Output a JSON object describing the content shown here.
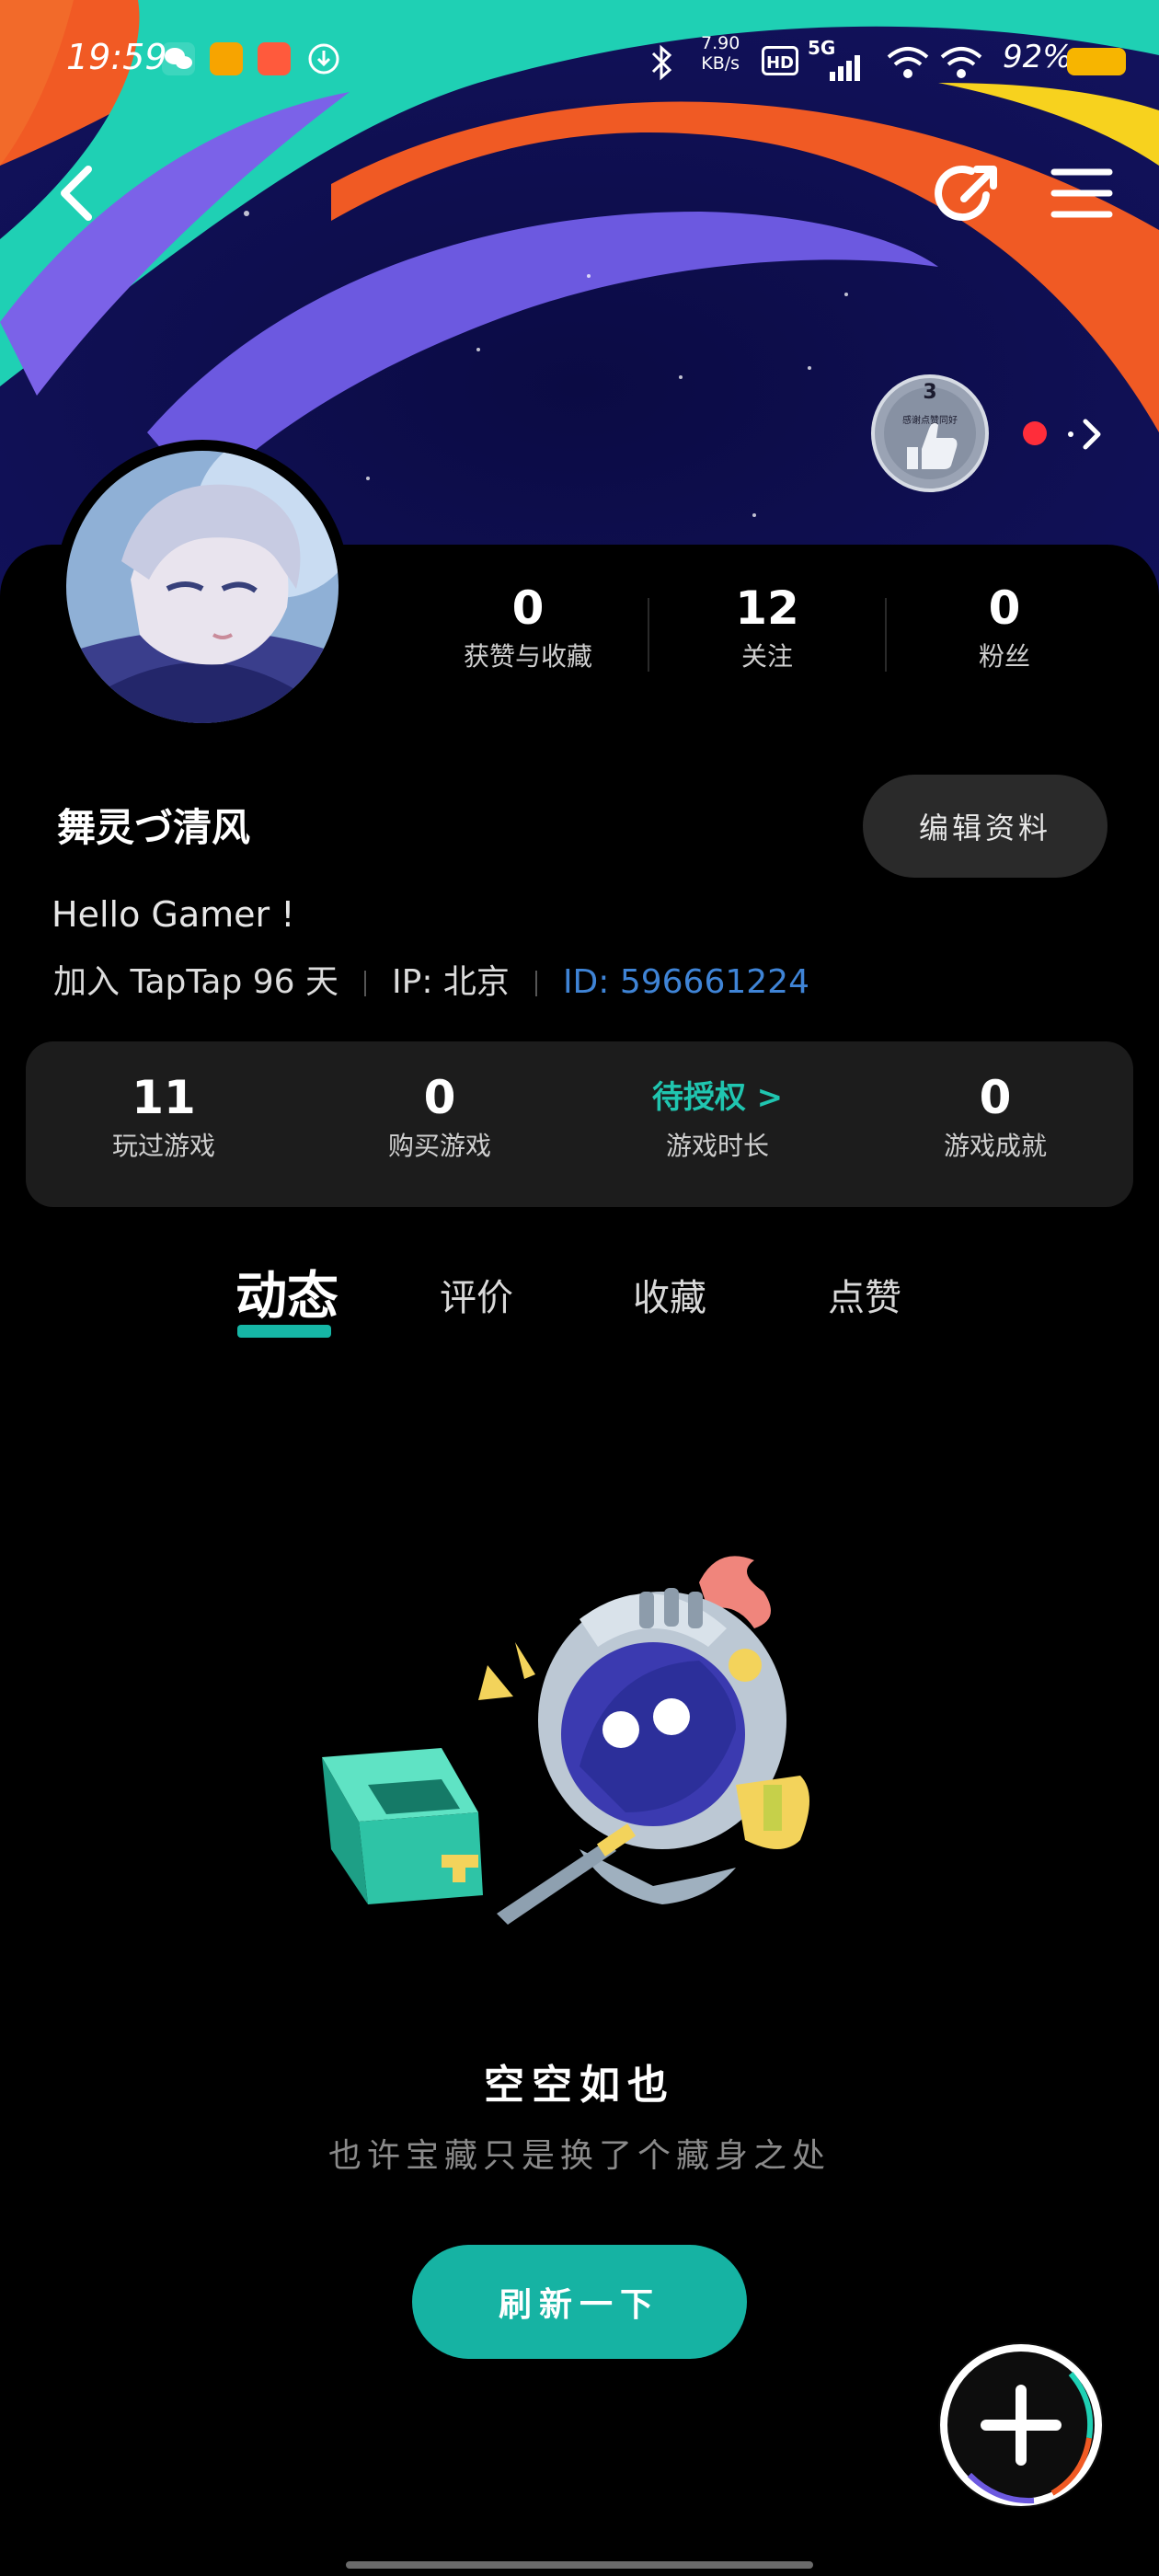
{
  "status_bar": {
    "time": "19:59",
    "speed_value": "7.90",
    "speed_unit": "KB/s",
    "hd_label": "HD",
    "network": "5G",
    "battery": "92%"
  },
  "profile": {
    "username": "舞灵づ清风",
    "edit_label": "编辑资料",
    "bio": "Hello Gamer !",
    "joined": "加入 TapTap 96 天",
    "ip": "IP: 北京",
    "user_id": "ID: 596661224",
    "badge_count": "3",
    "badge_caption": "感谢点赞同好"
  },
  "stats": [
    {
      "value": "0",
      "label": "获赞与收藏"
    },
    {
      "value": "12",
      "label": "关注"
    },
    {
      "value": "0",
      "label": "粉丝"
    }
  ],
  "game_stats": [
    {
      "value": "11",
      "label": "玩过游戏"
    },
    {
      "value": "0",
      "label": "购买游戏"
    },
    {
      "value": "待授权 >",
      "label": "游戏时长"
    },
    {
      "value": "0",
      "label": "游戏成就"
    }
  ],
  "tabs": [
    {
      "label": "动态",
      "active": true
    },
    {
      "label": "评价",
      "active": false
    },
    {
      "label": "收藏",
      "active": false
    },
    {
      "label": "点赞",
      "active": false
    }
  ],
  "empty_state": {
    "title": "空空如也",
    "subtitle": "也许宝藏只是换了个藏身之处",
    "button": "刷新一下"
  },
  "icons": {
    "back": "chevron-left-icon",
    "share": "share-icon",
    "menu": "hamburger-menu-icon",
    "fab": "plus-icon"
  },
  "colors": {
    "accent": "#16b6a6",
    "pending": "#20c5b0",
    "id_link": "#3f84d6",
    "notification_dot": "#ff2d3a"
  }
}
